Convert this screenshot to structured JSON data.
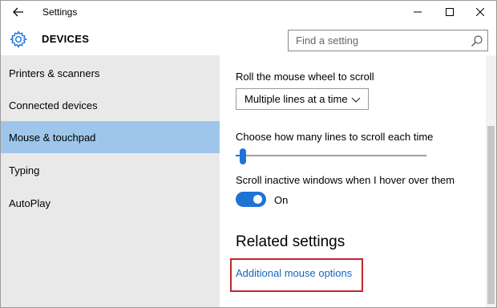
{
  "titlebar": {
    "title": "Settings"
  },
  "header": {
    "title": "DEVICES"
  },
  "search": {
    "placeholder": "Find a setting"
  },
  "sidebar": {
    "items": [
      {
        "label": "Printers & scanners"
      },
      {
        "label": "Connected devices"
      },
      {
        "label": "Mouse & touchpad"
      },
      {
        "label": "Typing"
      },
      {
        "label": "AutoPlay"
      }
    ],
    "active_index": 2
  },
  "content": {
    "scroll_label": "Roll the mouse wheel to scroll",
    "scroll_value": "Multiple lines at a time",
    "lines_label": "Choose how many lines to scroll each time",
    "lines_slider_fraction": 0.02,
    "inactive_label": "Scroll inactive windows when I hover over them",
    "inactive_toggle_on": true,
    "inactive_state": "On",
    "related_heading": "Related settings",
    "related_link": "Additional mouse options"
  },
  "colors": {
    "accent": "#1e73d6",
    "active_nav": "#9dc6ea",
    "sidebar_bg": "#e9e9e9",
    "link": "#1565c0",
    "highlight_border": "#c0272d"
  },
  "icons": {
    "back": "back-arrow-icon",
    "minimize": "minimize-icon",
    "maximize": "maximize-icon",
    "close": "close-icon",
    "header": "gear-icon",
    "search": "search-icon",
    "dropdown": "chevron-down-icon"
  }
}
